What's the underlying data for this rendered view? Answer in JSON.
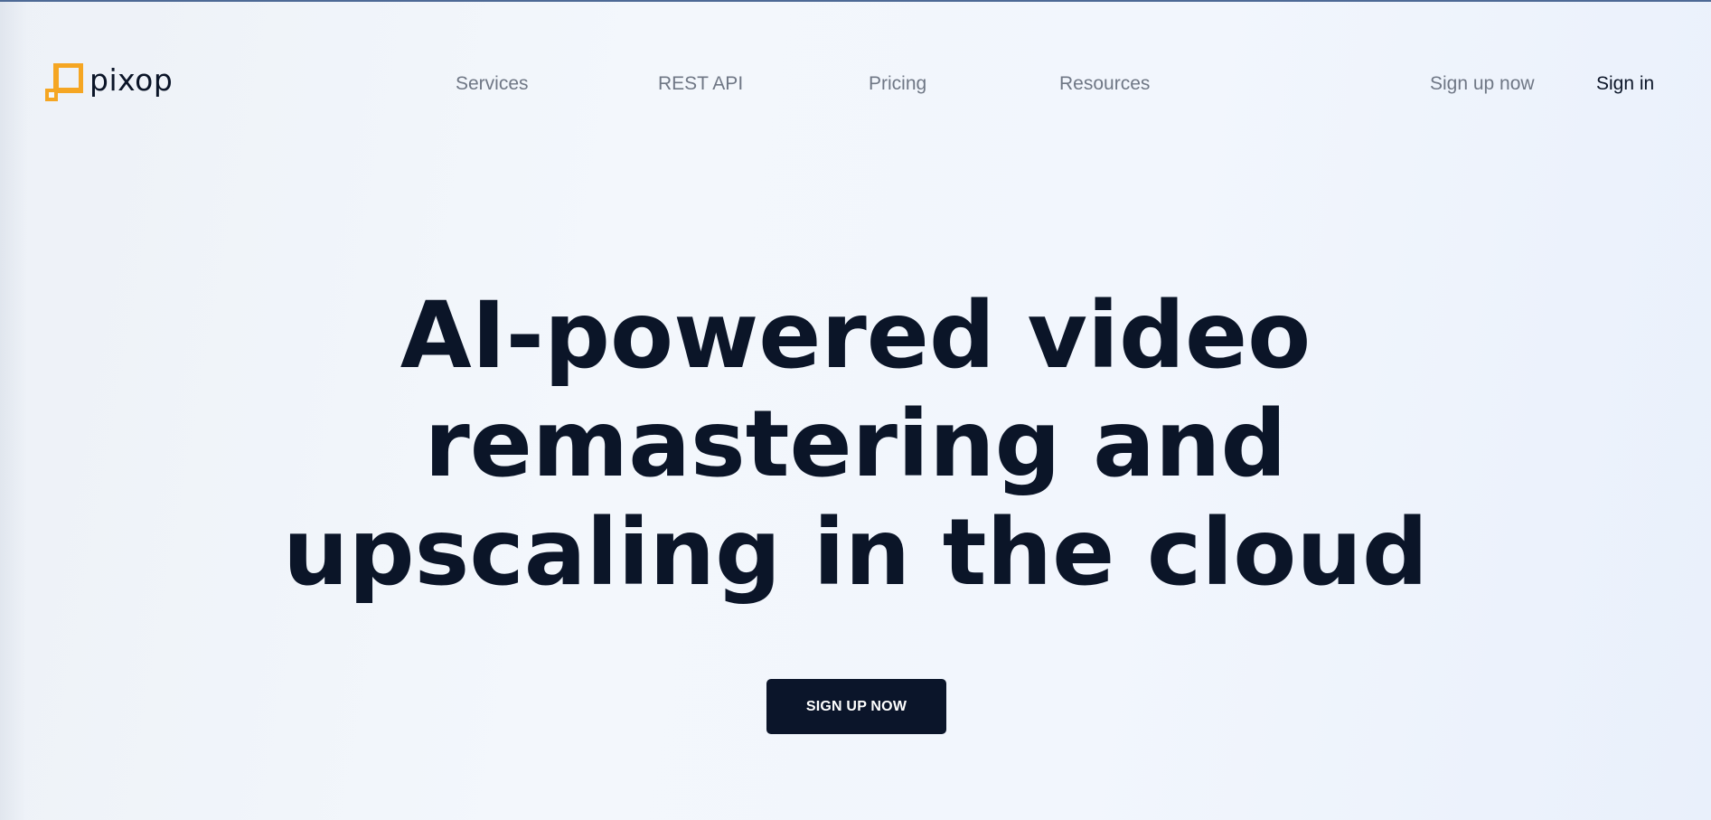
{
  "brand": {
    "name": "pixop",
    "accent_color": "#f5a623",
    "text_color": "#0b1528"
  },
  "nav": {
    "links": [
      {
        "label": "Services"
      },
      {
        "label": "REST API"
      },
      {
        "label": "Pricing"
      },
      {
        "label": "Resources"
      }
    ],
    "sign_up_label": "Sign up now",
    "sign_in_label": "Sign in"
  },
  "hero": {
    "title_lines": [
      "AI-powered video",
      "remastering and",
      "upscaling in the cloud"
    ],
    "cta_label": "SIGN UP NOW",
    "cta_color": "#0b152a"
  }
}
